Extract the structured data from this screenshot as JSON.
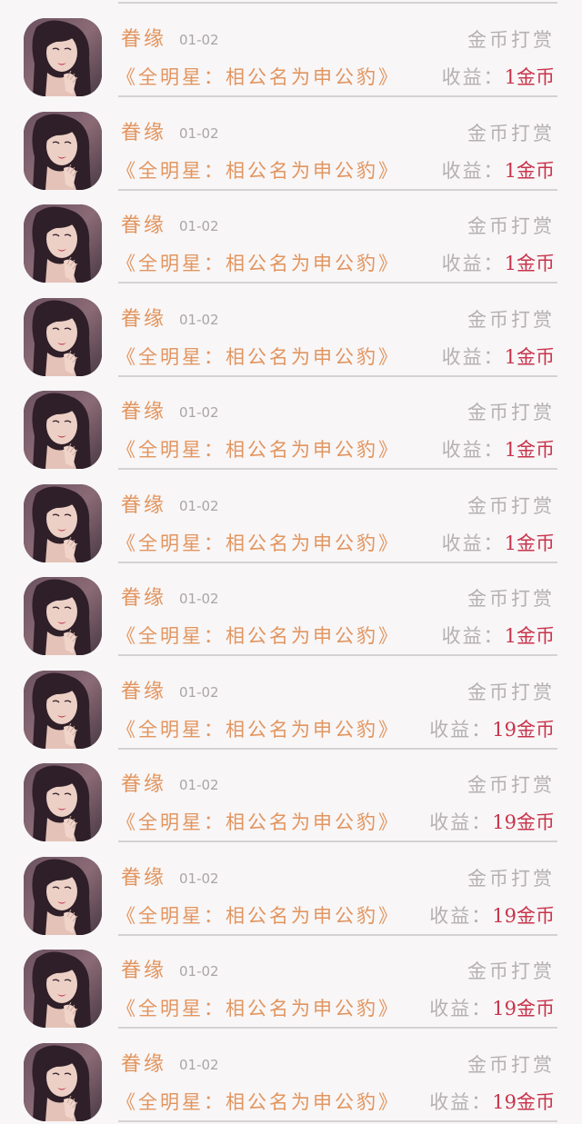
{
  "records": [
    {
      "user": "眷缘",
      "date": "01-02",
      "type": "金币打赏",
      "book": "《全明星：相公名为申公豹》",
      "income_label": "收益：",
      "income_value": "1金币"
    },
    {
      "user": "眷缘",
      "date": "01-02",
      "type": "金币打赏",
      "book": "《全明星：相公名为申公豹》",
      "income_label": "收益：",
      "income_value": "1金币"
    },
    {
      "user": "眷缘",
      "date": "01-02",
      "type": "金币打赏",
      "book": "《全明星：相公名为申公豹》",
      "income_label": "收益：",
      "income_value": "1金币"
    },
    {
      "user": "眷缘",
      "date": "01-02",
      "type": "金币打赏",
      "book": "《全明星：相公名为申公豹》",
      "income_label": "收益：",
      "income_value": "1金币"
    },
    {
      "user": "眷缘",
      "date": "01-02",
      "type": "金币打赏",
      "book": "《全明星：相公名为申公豹》",
      "income_label": "收益：",
      "income_value": "1金币"
    },
    {
      "user": "眷缘",
      "date": "01-02",
      "type": "金币打赏",
      "book": "《全明星：相公名为申公豹》",
      "income_label": "收益：",
      "income_value": "1金币"
    },
    {
      "user": "眷缘",
      "date": "01-02",
      "type": "金币打赏",
      "book": "《全明星：相公名为申公豹》",
      "income_label": "收益：",
      "income_value": "1金币"
    },
    {
      "user": "眷缘",
      "date": "01-02",
      "type": "金币打赏",
      "book": "《全明星：相公名为申公豹》",
      "income_label": "收益：",
      "income_value": "19金币"
    },
    {
      "user": "眷缘",
      "date": "01-02",
      "type": "金币打赏",
      "book": "《全明星：相公名为申公豹》",
      "income_label": "收益：",
      "income_value": "19金币"
    },
    {
      "user": "眷缘",
      "date": "01-02",
      "type": "金币打赏",
      "book": "《全明星：相公名为申公豹》",
      "income_label": "收益：",
      "income_value": "19金币"
    },
    {
      "user": "眷缘",
      "date": "01-02",
      "type": "金币打赏",
      "book": "《全明星：相公名为申公豹》",
      "income_label": "收益：",
      "income_value": "19金币"
    },
    {
      "user": "眷缘",
      "date": "01-02",
      "type": "金币打赏",
      "book": "《全明星：相公名为申公豹》",
      "income_label": "收益：",
      "income_value": "19金币"
    }
  ],
  "colors": {
    "accent": "#e2955f",
    "income_value": "#c8344b",
    "muted": "#b4b0b3",
    "background": "#f8f6f7"
  },
  "icons": {
    "avatar": "user-avatar-photo"
  }
}
